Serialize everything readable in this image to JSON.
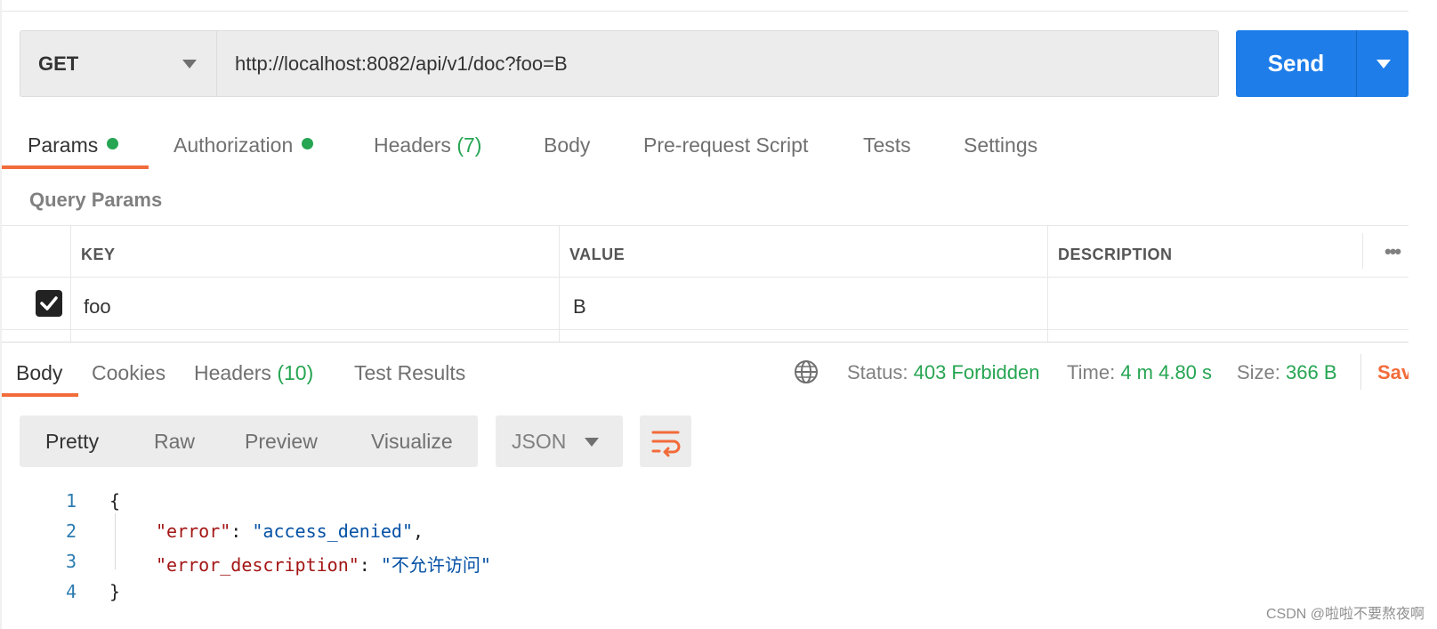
{
  "request": {
    "method": "GET",
    "url": "http://localhost:8082/api/v1/doc?foo=B",
    "send_label": "Send"
  },
  "request_tabs": [
    {
      "label": "Params",
      "dot": true,
      "active": true
    },
    {
      "label": "Authorization",
      "dot": true
    },
    {
      "label": "Headers",
      "count": "(7)"
    },
    {
      "label": "Body"
    },
    {
      "label": "Pre-request Script"
    },
    {
      "label": "Tests"
    },
    {
      "label": "Settings"
    }
  ],
  "params": {
    "section_title": "Query Params",
    "columns": [
      "KEY",
      "VALUE",
      "DESCRIPTION"
    ],
    "more_label": "•••",
    "rows": [
      {
        "checked": true,
        "key": "foo",
        "value": "B",
        "description": ""
      }
    ]
  },
  "response_tabs": [
    {
      "label": "Body",
      "active": true
    },
    {
      "label": "Cookies"
    },
    {
      "label": "Headers",
      "count": "(10)"
    },
    {
      "label": "Test Results"
    }
  ],
  "response_status": {
    "status_label": "Status:",
    "status_value": "403 Forbidden",
    "time_label": "Time:",
    "time_value": "4 m 4.80 s",
    "size_label": "Size:",
    "size_value": "366 B",
    "save_label": "Save"
  },
  "view_modes": [
    "Pretty",
    "Raw",
    "Preview",
    "Visualize"
  ],
  "format": "JSON",
  "code_lines": [
    {
      "n": "1",
      "open": "{"
    },
    {
      "n": "2",
      "key": "\"error\"",
      "value": "\"access_denied\"",
      "trail": ","
    },
    {
      "n": "3",
      "key": "\"error_description\"",
      "value": "\"不允许访问\"",
      "trail": ""
    },
    {
      "n": "4",
      "open": "}"
    }
  ],
  "watermark": "CSDN @啦啦不要熬夜啊",
  "colors": {
    "accent_orange": "#f26b3a",
    "send_blue": "#1e7de9",
    "success_green": "#26a552"
  }
}
